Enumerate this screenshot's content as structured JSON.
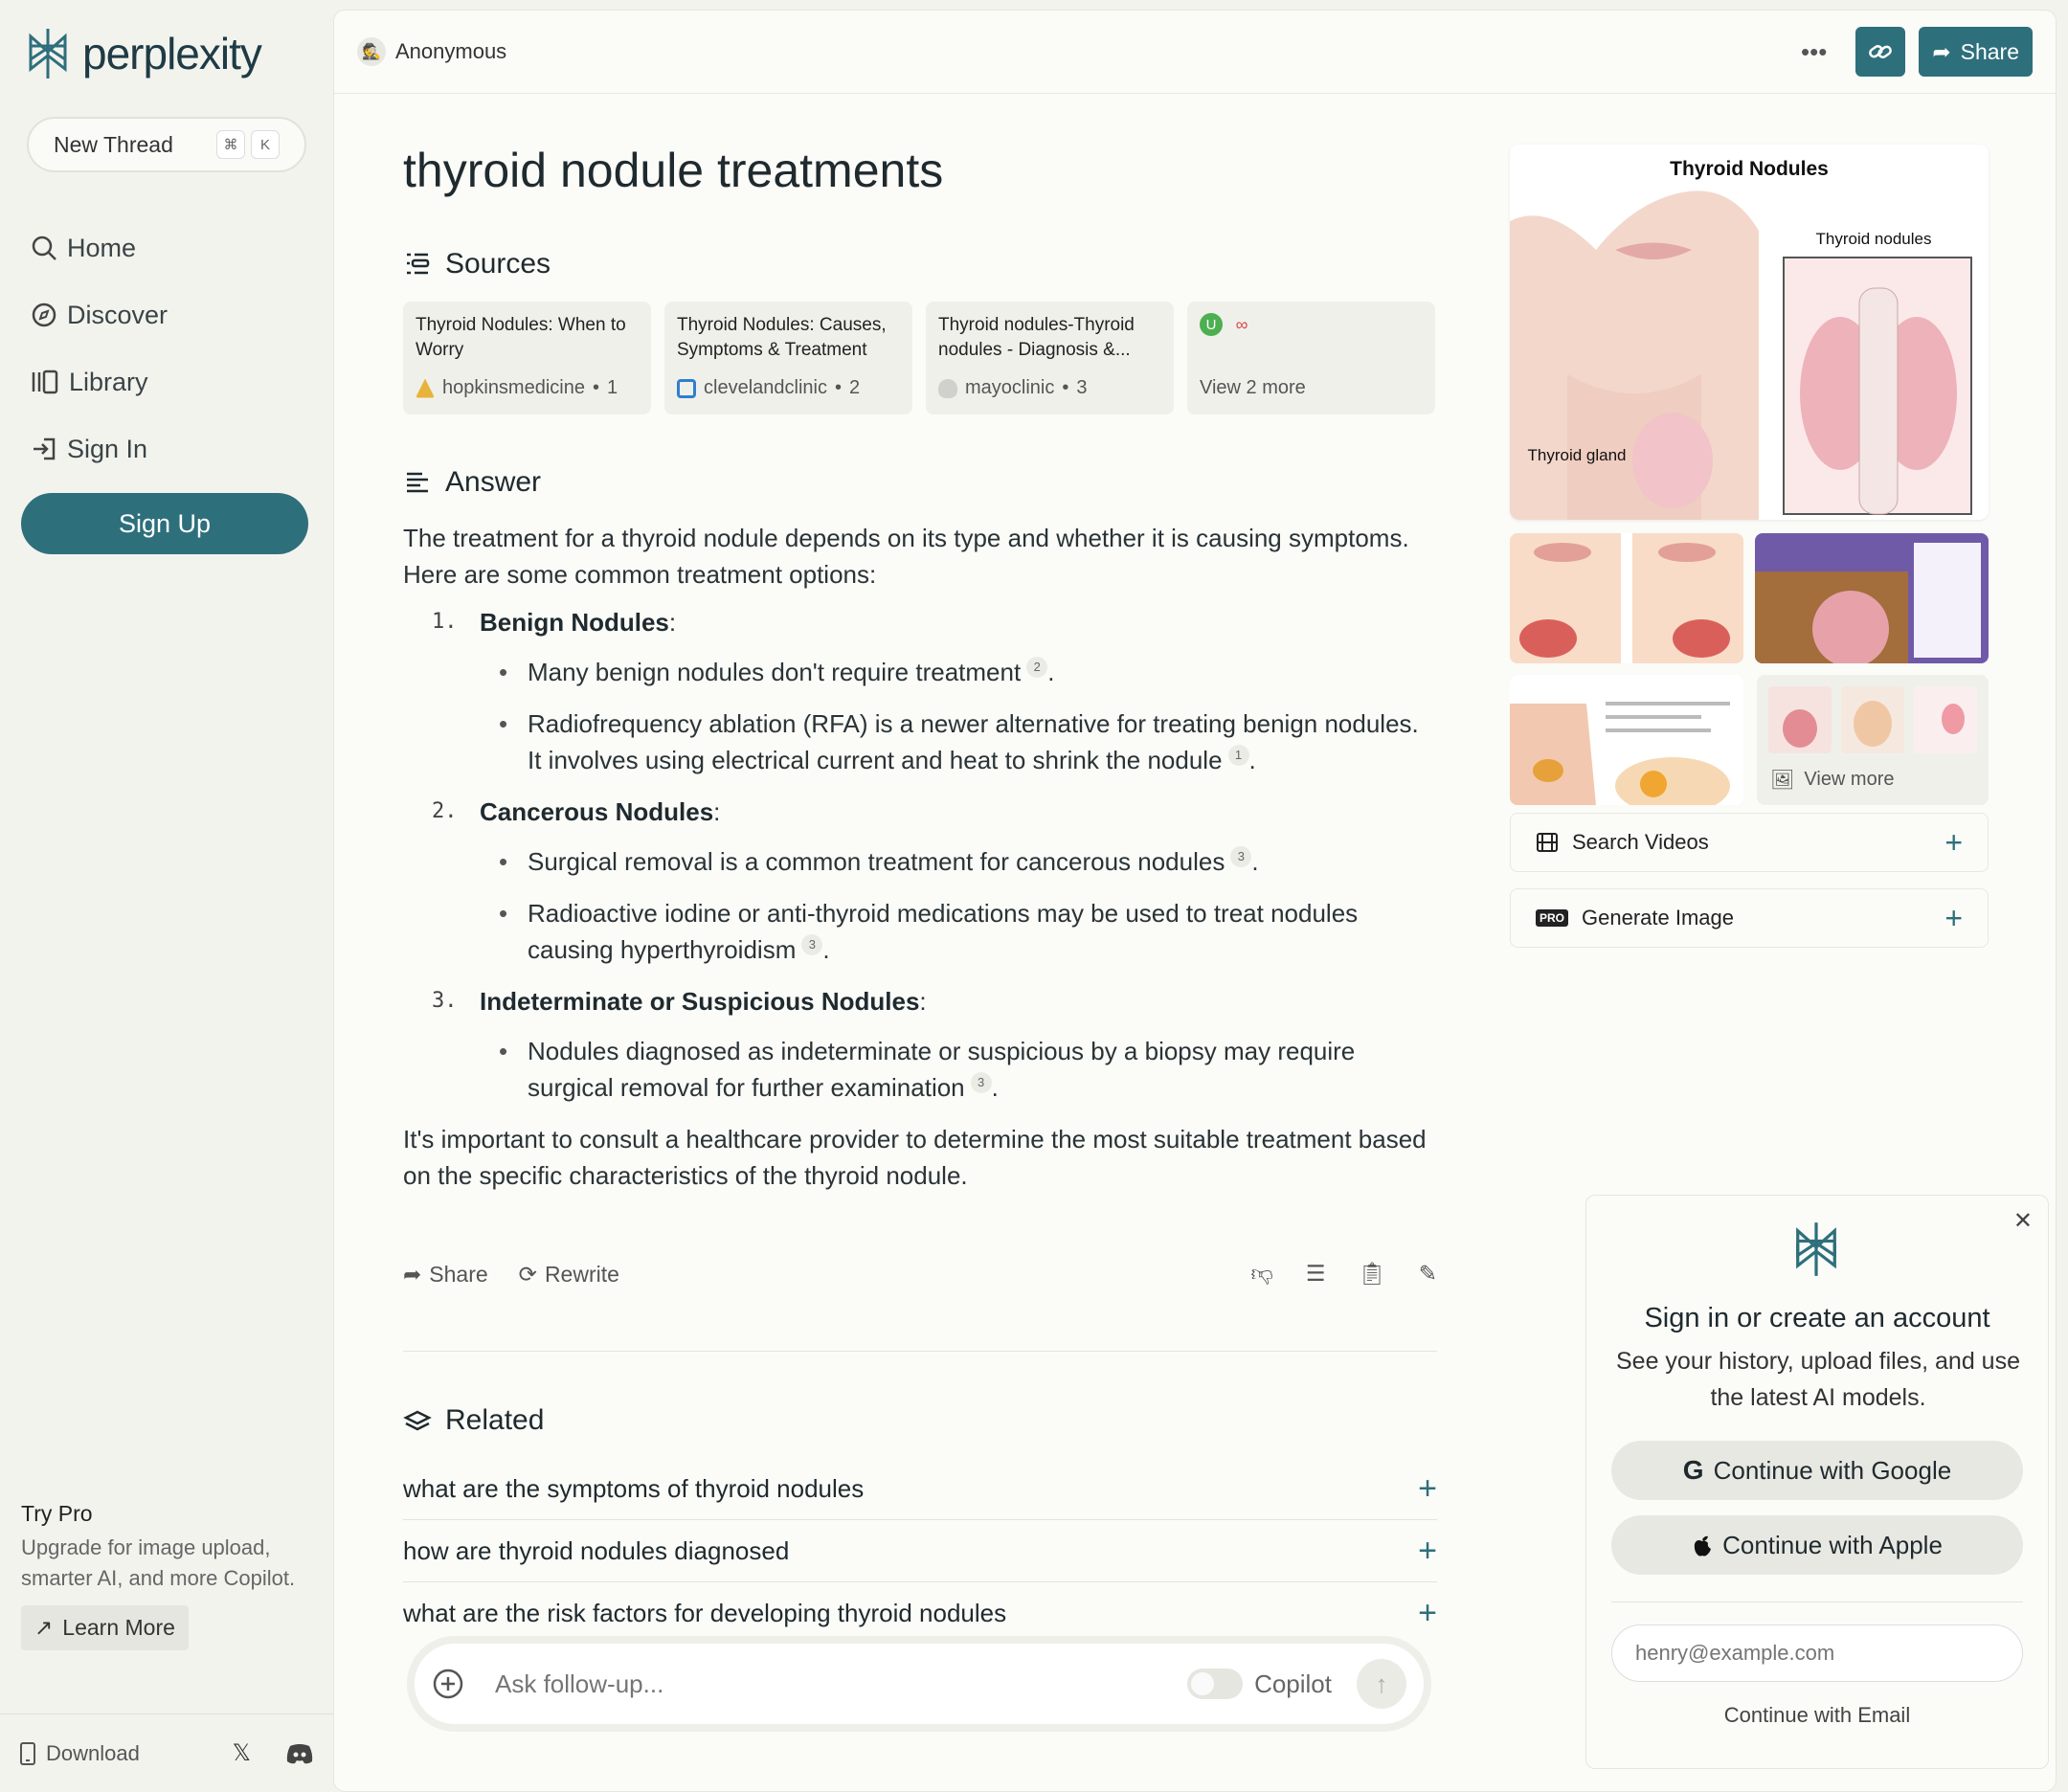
{
  "sidebar": {
    "brand": "perplexity",
    "new_thread": "New Thread",
    "shortcut": [
      "⌘",
      "K"
    ],
    "items": [
      {
        "label": "Home",
        "icon": "search-icon"
      },
      {
        "label": "Discover",
        "icon": "compass-icon"
      },
      {
        "label": "Library",
        "icon": "library-icon"
      },
      {
        "label": "Sign In",
        "icon": "sign-in-icon"
      }
    ],
    "signup": "Sign Up",
    "try_pro_title": "Try Pro",
    "try_pro_desc": "Upgrade for image upload, smarter AI, and more Copilot.",
    "learn_more": "Learn More",
    "download": "Download"
  },
  "header": {
    "user": "Anonymous",
    "share": "Share"
  },
  "thread": {
    "title": "thyroid nodule treatments",
    "sources_label": "Sources",
    "sources": [
      {
        "title": "Thyroid Nodules: When to Worry",
        "site": "hopkinsmedicine",
        "num": "1",
        "color": "#e8b33a"
      },
      {
        "title": "Thyroid Nodules: Causes, Symptoms & Treatment",
        "site": "clevelandclinic",
        "num": "2",
        "color": "#2f7fcf"
      },
      {
        "title": "Thyroid nodules-Thyroid nodules - Diagnosis &...",
        "site": "mayoclinic",
        "num": "3",
        "color": "#9a9a9a"
      }
    ],
    "view_more_sources": "View 2 more",
    "answer_label": "Answer",
    "intro": "The treatment for a thyroid nodule depends on its type and whether it is causing symptoms. Here are some common treatment options:",
    "sections": [
      {
        "num": "1.",
        "heading": "Benign Nodules",
        "bullets": [
          {
            "text": "Many benign nodules don't require treatment",
            "cite": "2"
          },
          {
            "text": "Radiofrequency ablation (RFA) is a newer alternative for treating benign nodules. It involves using electrical current and heat to shrink the nodule",
            "cite": "1"
          }
        ]
      },
      {
        "num": "2.",
        "heading": "Cancerous Nodules",
        "bullets": [
          {
            "text": "Surgical removal is a common treatment for cancerous nodules",
            "cite": "3"
          },
          {
            "text": "Radioactive iodine or anti-thyroid medications may be used to treat nodules causing hyperthyroidism",
            "cite": "3"
          }
        ]
      },
      {
        "num": "3.",
        "heading": "Indeterminate or Suspicious Nodules",
        "bullets": [
          {
            "text": "Nodules diagnosed as indeterminate or suspicious by a biopsy may require surgical removal for further examination",
            "cite": "3"
          }
        ]
      }
    ],
    "conclusion": "It's important to consult a healthcare provider to determine the most suitable treatment based on the specific characteristics of the thyroid nodule.",
    "actions": {
      "share": "Share",
      "rewrite": "Rewrite"
    },
    "related_label": "Related",
    "related": [
      "what are the symptoms of thyroid nodules",
      "how are thyroid nodules diagnosed",
      "what are the risk factors for developing thyroid nodules"
    ],
    "followup_placeholder": "Ask follow-up...",
    "copilot": "Copilot"
  },
  "media": {
    "main_image_title": "Thyroid Nodules",
    "main_image_label_1": "Thyroid nodules",
    "main_image_label_2": "Thyroid gland",
    "view_more": "View more",
    "search_videos": "Search Videos",
    "generate_image": "Generate Image",
    "pro_badge": "PRO"
  },
  "signin": {
    "heading": "Sign in or create an account",
    "desc": "See your history, upload files, and use the latest AI models.",
    "google": "Continue with Google",
    "apple": "Continue with Apple",
    "email_placeholder": "henry@example.com",
    "email_button": "Continue with Email"
  },
  "colors": {
    "accent": "#2e6f7c"
  }
}
